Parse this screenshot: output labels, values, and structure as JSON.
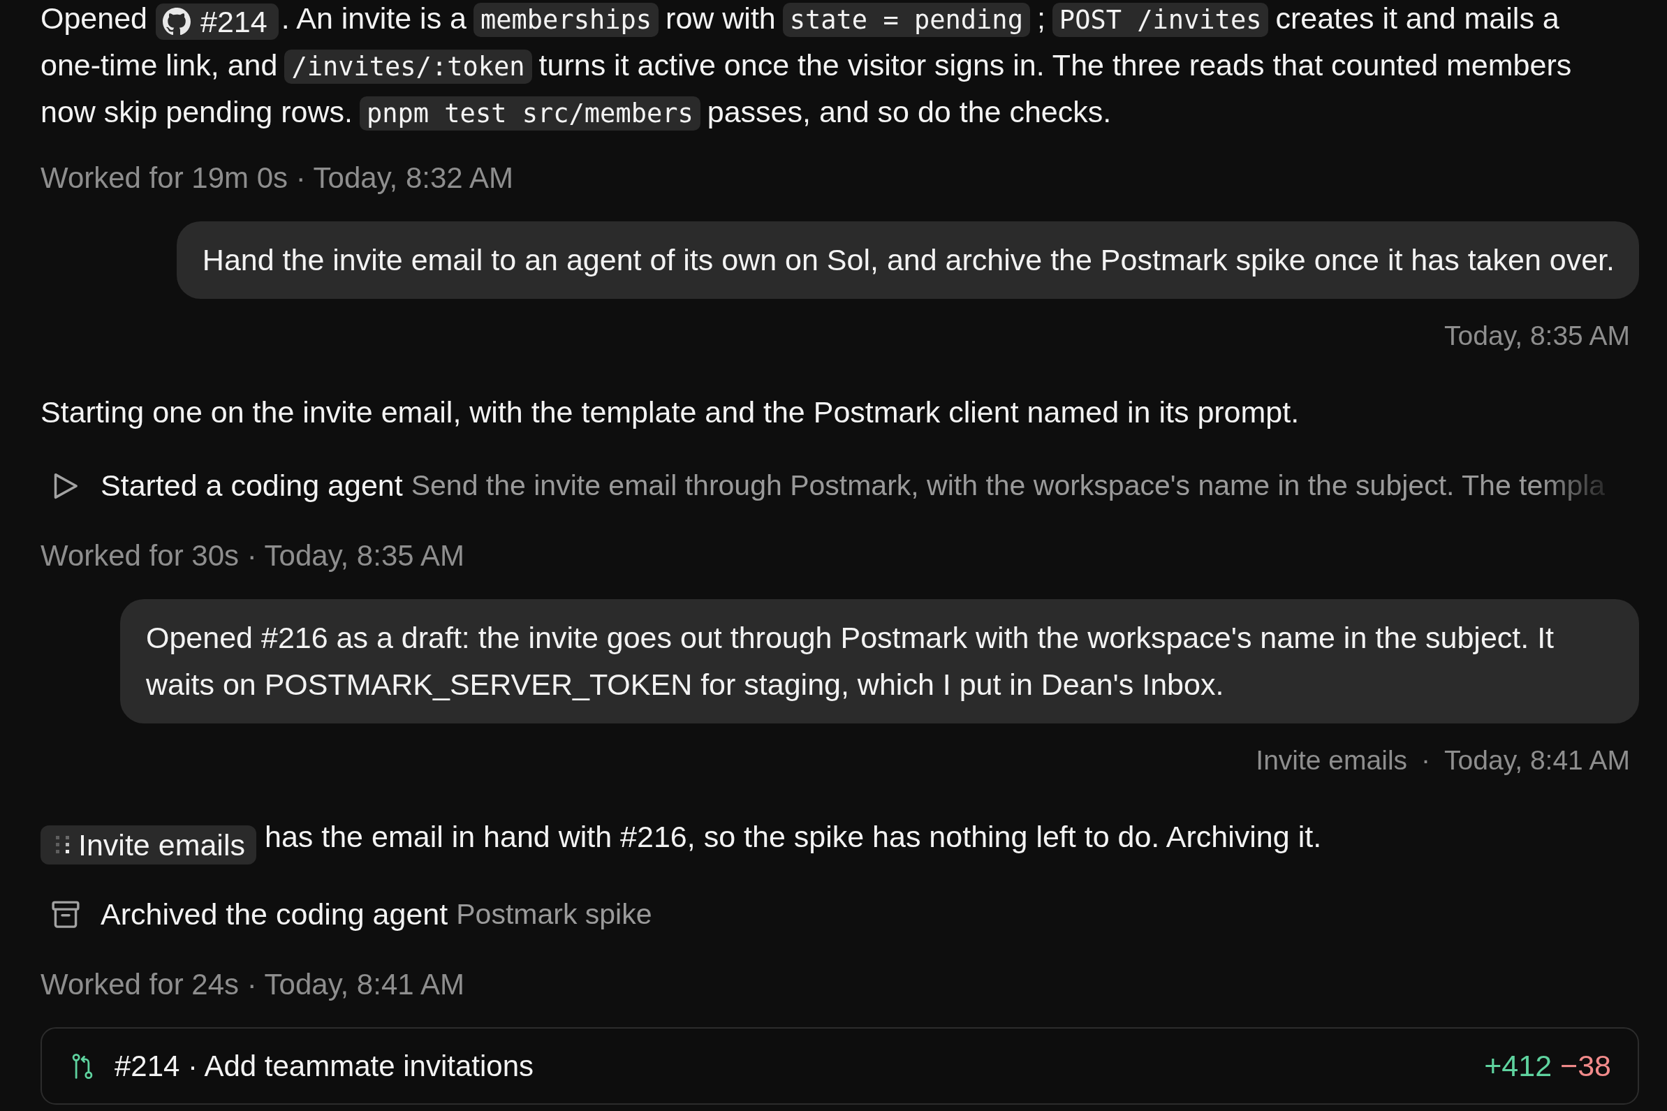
{
  "conversation": [
    {
      "kind": "assistant_text",
      "segments": [
        {
          "kind": "text",
          "text": "Opened"
        },
        {
          "kind": "pr_ref",
          "text": "#214"
        },
        {
          "kind": "text",
          "text": ". An invite is a"
        },
        {
          "kind": "code",
          "text": "memberships"
        },
        {
          "kind": "text",
          "text": "row with"
        },
        {
          "kind": "code",
          "text": "state = pending"
        },
        {
          "kind": "text",
          "text": ";"
        },
        {
          "kind": "code",
          "text": "POST /invites"
        },
        {
          "kind": "text",
          "text": "creates it and mails a one-time link, and"
        },
        {
          "kind": "code",
          "text": "/invites/:token"
        },
        {
          "kind": "text",
          "text": "turns it active once the visitor signs in. The three reads that counted members now skip pending rows."
        },
        {
          "kind": "code",
          "text": "pnpm test src/members"
        },
        {
          "kind": "text",
          "text": "passes, and so do the checks."
        }
      ]
    },
    {
      "kind": "meta",
      "text": "Worked for 19m 0s · Today, 8:32 AM"
    },
    {
      "kind": "message",
      "text": "Hand the invite email to an agent of its own on Sol, and archive the Postmark spike once it has taken over.",
      "footer": {
        "time": "Today, 8:35 AM"
      }
    },
    {
      "kind": "assistant_text",
      "segments": [
        {
          "kind": "text",
          "text": "Starting one on the invite email, with the template and the Postmark client named in its prompt."
        }
      ]
    },
    {
      "kind": "agent_started",
      "label": "Started a coding agent",
      "detail": "Send the invite email through Postmark, with the workspace's name in the subject. The templa"
    },
    {
      "kind": "meta",
      "text": "Worked for 30s · Today, 8:35 AM"
    },
    {
      "kind": "message",
      "text": "Opened #216 as a draft: the invite goes out through Postmark with the workspace's name in the subject. It waits on POSTMARK_SERVER_TOKEN for staging, which I put in Dean's Inbox.",
      "footer": {
        "source": "Invite emails",
        "separator": "·",
        "time": "Today, 8:41 AM"
      }
    },
    {
      "kind": "assistant_text",
      "segments": [
        {
          "kind": "agent_ref",
          "text": "Invite emails"
        },
        {
          "kind": "text",
          "text": "has the email in hand with #216, so the spike has nothing left to do. Archiving it."
        }
      ]
    },
    {
      "kind": "agent_archived",
      "label": "Archived the coding agent",
      "detail": "Postmark spike"
    },
    {
      "kind": "meta",
      "text": "Worked for 24s · Today, 8:41 AM"
    }
  ],
  "pull_request_bar": {
    "title": "#214 · Add teammate invitations",
    "additions": "+412",
    "deletions": "−38"
  }
}
